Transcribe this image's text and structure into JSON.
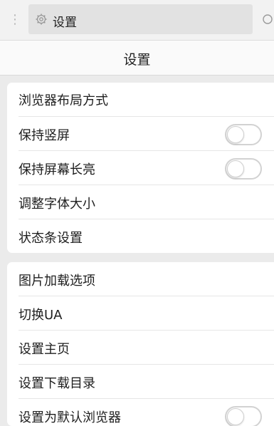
{
  "tab": {
    "title": "设置",
    "icon": "gear-icon"
  },
  "toolbar": {
    "menu_icon": "more-vertical-icon",
    "refresh_icon": "refresh-icon"
  },
  "header": {
    "title": "设置"
  },
  "sections": [
    {
      "items": [
        {
          "label": "浏览器布局方式"
        },
        {
          "label": "保持竖屏",
          "toggle": false
        },
        {
          "label": "保持屏幕长亮",
          "toggle": false
        },
        {
          "label": "调整字体大小"
        },
        {
          "label": "状态条设置"
        }
      ]
    },
    {
      "items": [
        {
          "label": "图片加载选项"
        },
        {
          "label": "切换UA"
        },
        {
          "label": "设置主页"
        },
        {
          "label": "设置下载目录"
        },
        {
          "label": "设置为默认浏览器",
          "toggle": false
        }
      ]
    }
  ],
  "colors": {
    "background": "#ebebeb",
    "card": "#ffffff",
    "tab": "#e2e2e2",
    "toggle_off": "#d2d2d2"
  }
}
